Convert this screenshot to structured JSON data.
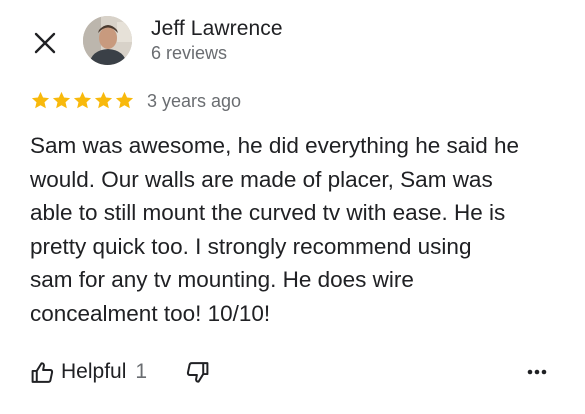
{
  "author": {
    "name": "Jeff Lawrence",
    "reviews_count": "6 reviews"
  },
  "rating": {
    "stars": 5,
    "max": 5,
    "star_color": "#f8b90c"
  },
  "review": {
    "date": "3 years ago",
    "text": "Sam was awesome, he did everything he said he\nwould. Our walls are made of placer, Sam was\nable to still mount the curved tv with ease. He is\npretty quick too. I strongly recommend using\nsam for any tv mounting. He does wire\nconcealment too! 10/10!"
  },
  "actions": {
    "helpful_label": "Helpful",
    "helpful_count": "1"
  },
  "icons": {
    "close": "close-icon",
    "thumbs_up": "thumbs-up-icon",
    "thumbs_down": "thumbs-down-icon",
    "more": "more-horizontal-icon"
  }
}
